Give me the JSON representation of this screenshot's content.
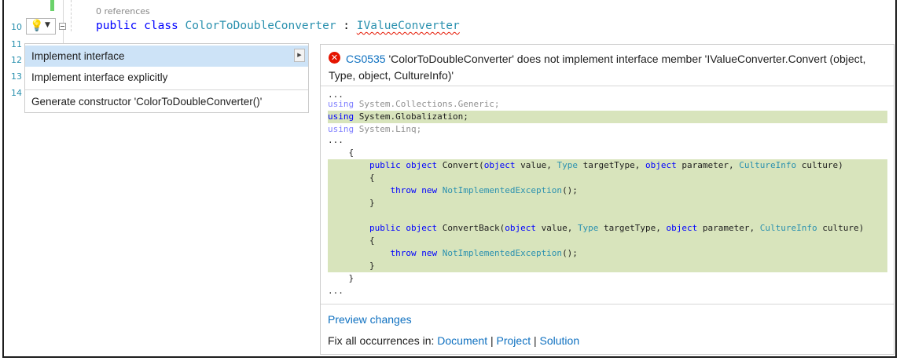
{
  "editor": {
    "references": "0 references",
    "line_numbers": [
      "10",
      "11",
      "12",
      "13",
      "14"
    ],
    "code": {
      "public": "public",
      "class": "class",
      "class_name": "ColorToDoubleConverter",
      "colon": " : ",
      "interface": "IValueConverter"
    }
  },
  "lightbulb": {
    "icon": "lightbulb-icon",
    "dropdown": "▼"
  },
  "menu": {
    "items": [
      {
        "label": "Implement interface"
      },
      {
        "label": "Implement interface explicitly"
      },
      {
        "label": "Generate constructor 'ColorToDoubleConverter()'"
      }
    ],
    "submenu_arrow": "▶"
  },
  "preview": {
    "error_icon": "error-icon",
    "error_code": "CS0535",
    "error_message": " 'ColorToDoubleConverter' does not implement interface member 'IValueConverter.Convert (object, Type, object, CultureInfo)'",
    "code_lines": [
      "...",
      "using System.Collections.Generic;",
      "using System.Globalization;",
      "using System.Linq;",
      "...",
      "    {",
      "        public object Convert(object value, Type targetType, object parameter, CultureInfo culture)",
      "        {",
      "            throw new NotImplementedException();",
      "        }",
      "",
      "        public object ConvertBack(object value, Type targetType, object parameter, CultureInfo culture)",
      "        {",
      "            throw new NotImplementedException();",
      "        }",
      "    }",
      "..."
    ],
    "preview_changes": "Preview changes",
    "fix_all_prefix": "Fix all occurrences in: ",
    "fix_document": "Document",
    "fix_project": "Project",
    "fix_solution": "Solution",
    "separator": " | "
  },
  "colors": {
    "keyword": "#0000ff",
    "type": "#2b91af",
    "highlight": "#d8e4bc",
    "link": "#0e70c0",
    "error": "#e51400"
  }
}
